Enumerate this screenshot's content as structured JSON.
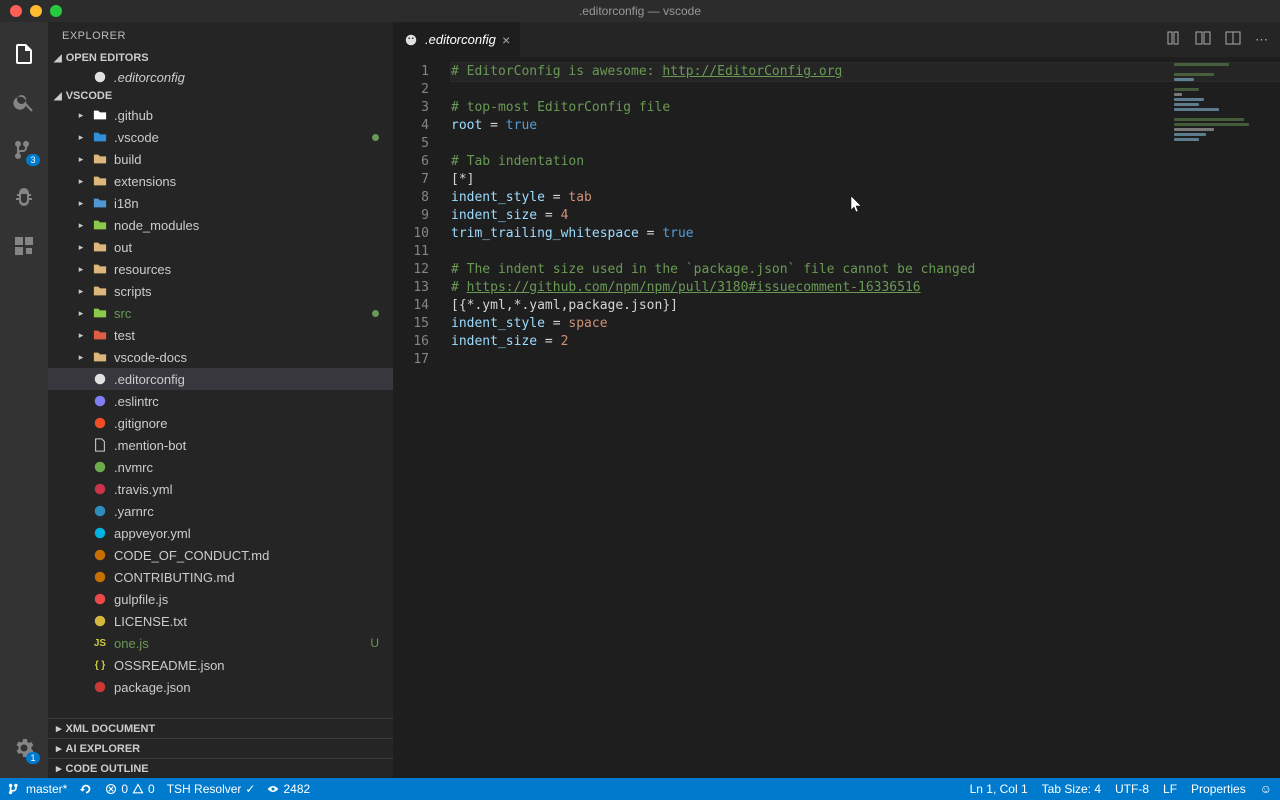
{
  "window": {
    "title": ".editorconfig — vscode"
  },
  "explorer": {
    "title": "EXPLORER",
    "open_editors_label": "OPEN EDITORS",
    "open_editors": [
      {
        "name": ".editorconfig",
        "icon": "editorconfig-icon"
      }
    ],
    "workspace_label": "VSCODE",
    "tree": [
      {
        "type": "folder",
        "name": ".github",
        "icon": "github-icon",
        "iconColor": "#fff"
      },
      {
        "type": "folder",
        "name": ".vscode",
        "icon": "vscode-folder-icon",
        "modified": true,
        "iconColor": "#2f8fd8"
      },
      {
        "type": "folder",
        "name": "build",
        "icon": "folder-icon",
        "iconColor": "#dcb67a"
      },
      {
        "type": "folder",
        "name": "extensions",
        "icon": "folder-icon",
        "iconColor": "#dcb67a"
      },
      {
        "type": "folder",
        "name": "i18n",
        "icon": "i18n-icon",
        "iconColor": "#5098d4"
      },
      {
        "type": "folder",
        "name": "node_modules",
        "icon": "node-icon",
        "iconColor": "#8cc84b"
      },
      {
        "type": "folder",
        "name": "out",
        "icon": "folder-icon",
        "iconColor": "#dcb67a"
      },
      {
        "type": "folder",
        "name": "resources",
        "icon": "folder-icon",
        "iconColor": "#dcb67a"
      },
      {
        "type": "folder",
        "name": "scripts",
        "icon": "folder-icon",
        "iconColor": "#dcb67a"
      },
      {
        "type": "folder",
        "name": "src",
        "icon": "src-icon",
        "modified": true,
        "green": true,
        "iconColor": "#8cc84b"
      },
      {
        "type": "folder",
        "name": "test",
        "icon": "test-icon",
        "iconColor": "#e05d44"
      },
      {
        "type": "folder",
        "name": "vscode-docs",
        "icon": "folder-icon",
        "iconColor": "#dcb67a"
      },
      {
        "type": "file",
        "name": ".editorconfig",
        "icon": "editorconfig-icon",
        "selected": true,
        "iconColor": "#e0e0e0"
      },
      {
        "type": "file",
        "name": ".eslintrc",
        "icon": "eslint-icon",
        "iconColor": "#8080f2"
      },
      {
        "type": "file",
        "name": ".gitignore",
        "icon": "git-icon",
        "iconColor": "#f14c28"
      },
      {
        "type": "file",
        "name": ".mention-bot",
        "icon": "file-icon",
        "iconColor": "#ccc"
      },
      {
        "type": "file",
        "name": ".nvmrc",
        "icon": "nvm-icon",
        "iconColor": "#6cac4d"
      },
      {
        "type": "file",
        "name": ".travis.yml",
        "icon": "travis-icon",
        "iconColor": "#cb3349"
      },
      {
        "type": "file",
        "name": ".yarnrc",
        "icon": "yarn-icon",
        "iconColor": "#2c8ebb"
      },
      {
        "type": "file",
        "name": "appveyor.yml",
        "icon": "appveyor-icon",
        "iconColor": "#00b3e0"
      },
      {
        "type": "file",
        "name": "CODE_OF_CONDUCT.md",
        "icon": "md-icon",
        "iconColor": "#C76e00"
      },
      {
        "type": "file",
        "name": "CONTRIBUTING.md",
        "icon": "md-icon",
        "iconColor": "#C76e00"
      },
      {
        "type": "file",
        "name": "gulpfile.js",
        "icon": "gulp-icon",
        "iconColor": "#eb4a4b"
      },
      {
        "type": "file",
        "name": "LICENSE.txt",
        "icon": "license-icon",
        "iconColor": "#d4b73e"
      },
      {
        "type": "file",
        "name": "one.js",
        "icon": "js-icon",
        "status": "U",
        "green": true,
        "iconColor": "#cbcb41"
      },
      {
        "type": "file",
        "name": "OSSREADME.json",
        "icon": "json-icon",
        "iconColor": "#cbcb41"
      },
      {
        "type": "file",
        "name": "package.json",
        "icon": "npm-icon",
        "iconColor": "#cb3837"
      }
    ],
    "collapsed_sections": [
      "XML DOCUMENT",
      "AI EXPLORER",
      "CODE OUTLINE"
    ]
  },
  "activity_badge": "3",
  "settings_badge": "1",
  "editor": {
    "tab": {
      "name": ".editorconfig"
    },
    "lines": [
      [
        {
          "t": "# EditorConfig is awesome: ",
          "c": "c-comment"
        },
        {
          "t": "http://EditorConfig.org",
          "c": "c-link"
        }
      ],
      [],
      [
        {
          "t": "# top-most EditorConfig file",
          "c": "c-comment"
        }
      ],
      [
        {
          "t": "root",
          "c": "c-key"
        },
        {
          "t": " = ",
          "c": "c-op"
        },
        {
          "t": "true",
          "c": "c-bool"
        }
      ],
      [],
      [
        {
          "t": "# Tab indentation",
          "c": "c-comment"
        }
      ],
      [
        {
          "t": "[*]",
          "c": "c-section"
        }
      ],
      [
        {
          "t": "indent_style",
          "c": "c-key"
        },
        {
          "t": " = ",
          "c": "c-op"
        },
        {
          "t": "tab",
          "c": "c-val"
        }
      ],
      [
        {
          "t": "indent_size",
          "c": "c-key"
        },
        {
          "t": " = ",
          "c": "c-op"
        },
        {
          "t": "4",
          "c": "c-val"
        }
      ],
      [
        {
          "t": "trim_trailing_whitespace",
          "c": "c-key"
        },
        {
          "t": " = ",
          "c": "c-op"
        },
        {
          "t": "true",
          "c": "c-bool"
        }
      ],
      [],
      [
        {
          "t": "# The indent size used in the `package.json` file cannot be changed",
          "c": "c-comment"
        }
      ],
      [
        {
          "t": "# ",
          "c": "c-comment"
        },
        {
          "t": "https://github.com/npm/npm/pull/3180#issuecomment-16336516",
          "c": "c-link"
        }
      ],
      [
        {
          "t": "[{*.yml,*.yaml,package.json}]",
          "c": "c-section"
        }
      ],
      [
        {
          "t": "indent_style",
          "c": "c-key"
        },
        {
          "t": " = ",
          "c": "c-op"
        },
        {
          "t": "space",
          "c": "c-val"
        }
      ],
      [
        {
          "t": "indent_size",
          "c": "c-key"
        },
        {
          "t": " = ",
          "c": "c-op"
        },
        {
          "t": "2",
          "c": "c-val"
        }
      ],
      []
    ]
  },
  "statusbar": {
    "branch": "master*",
    "errors": "0",
    "warnings": "0",
    "tsh": "TSH Resolver",
    "port": "2482",
    "ln_col": "Ln 1, Col 1",
    "tab_size": "Tab Size: 4",
    "encoding": "UTF-8",
    "eol": "LF",
    "lang": "Properties"
  }
}
